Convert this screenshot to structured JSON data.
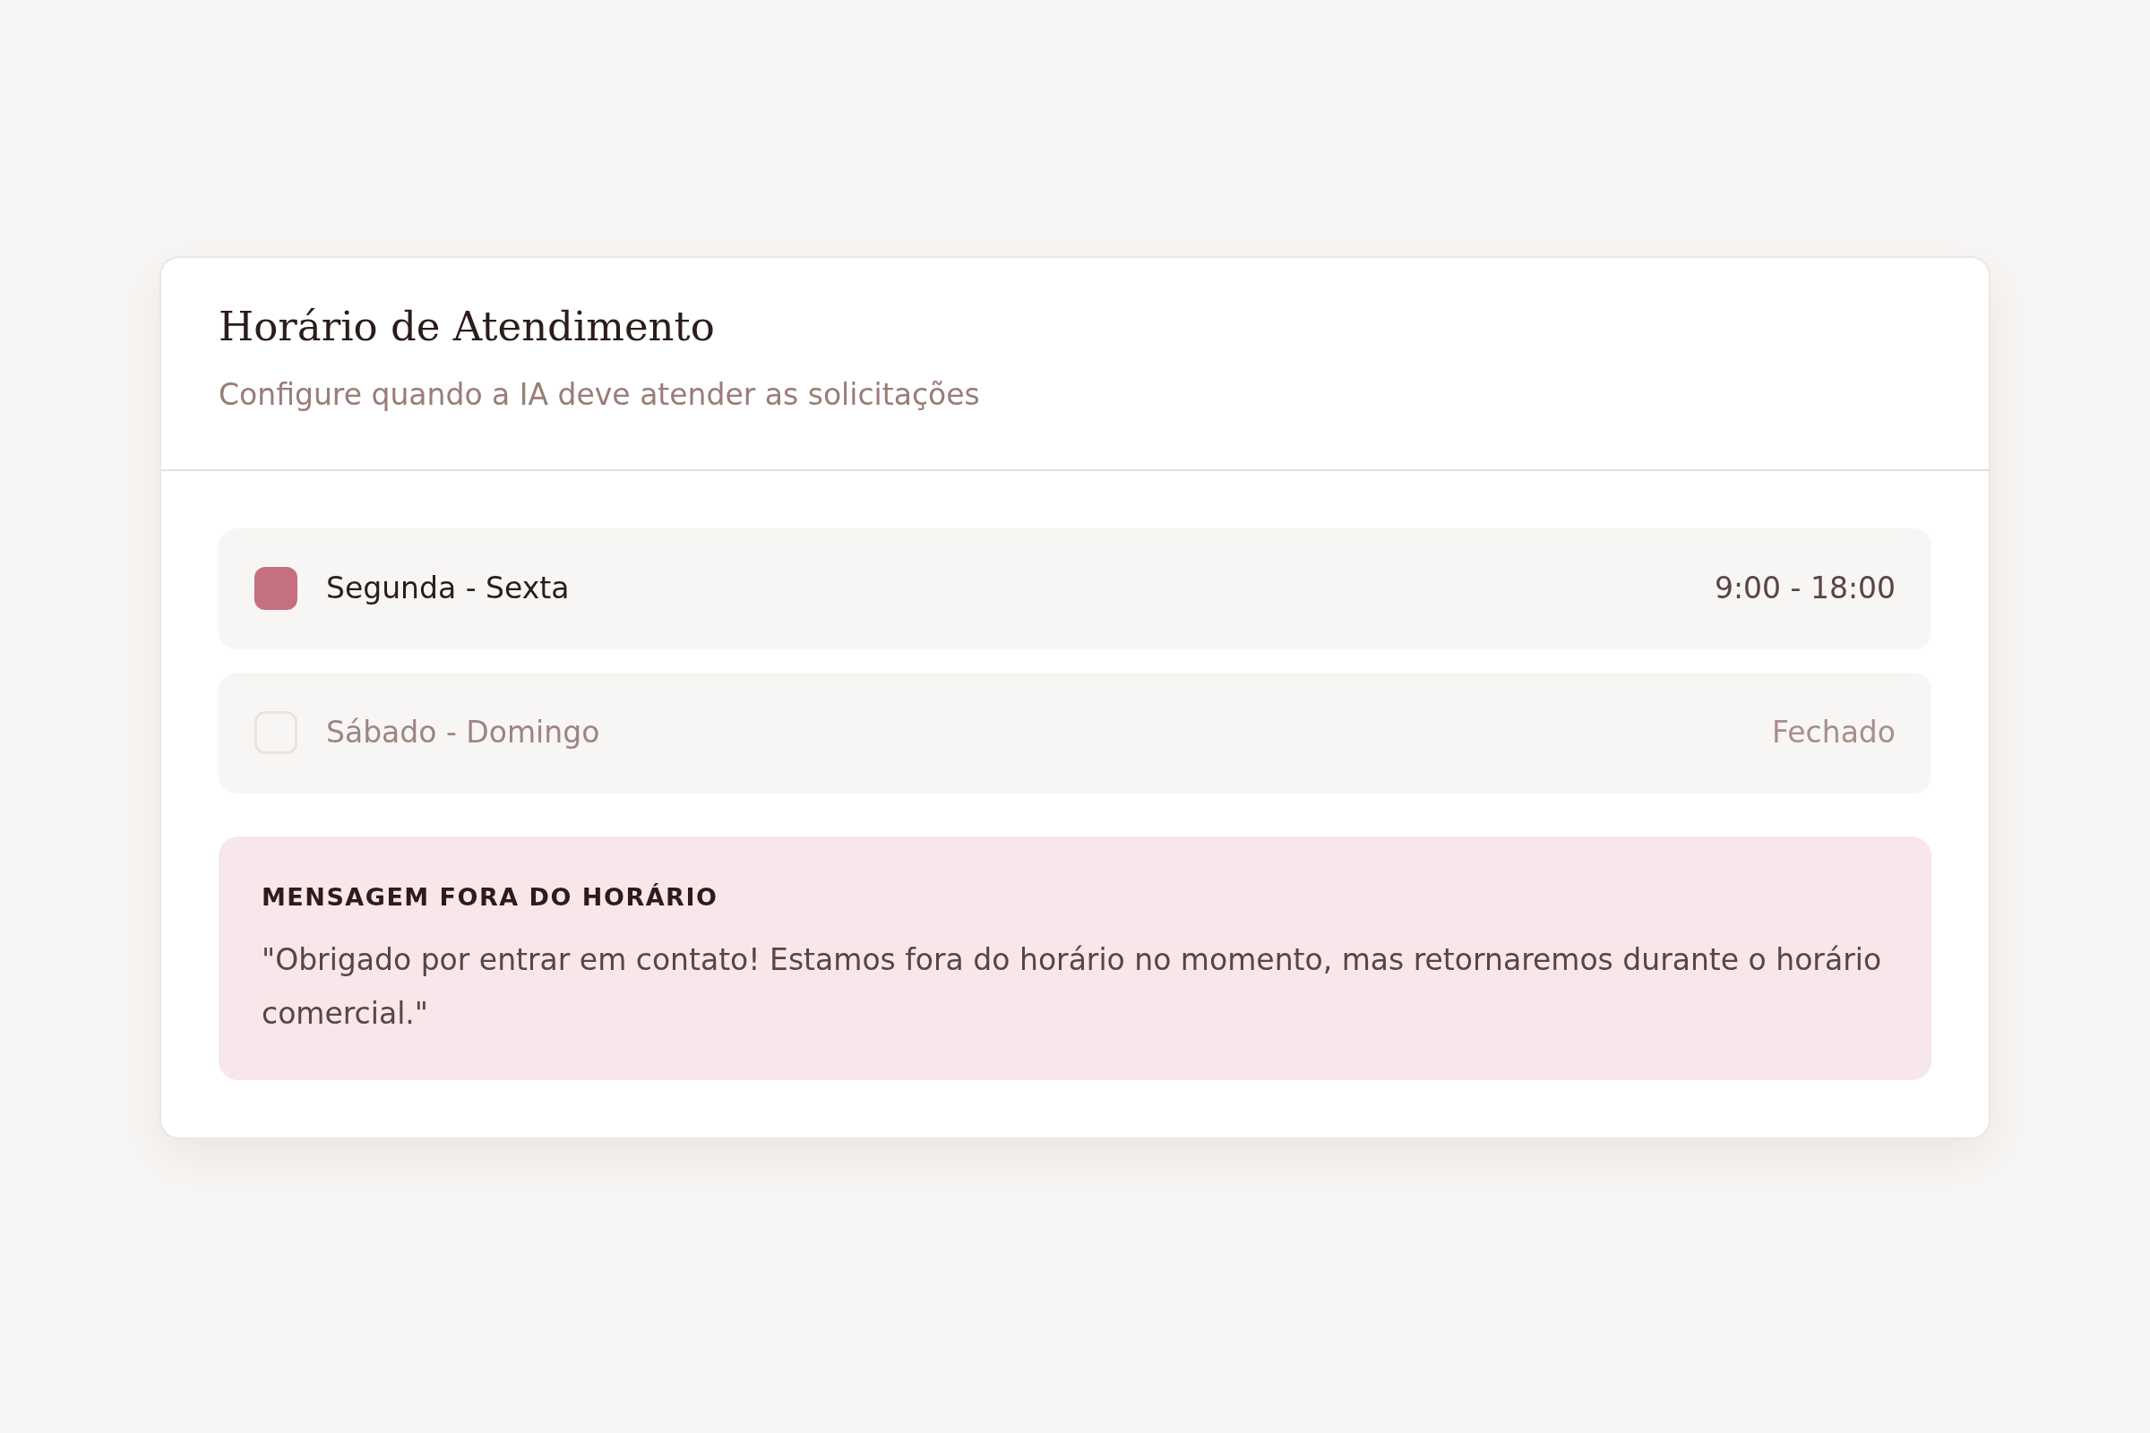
{
  "card": {
    "title": "Horário de Atendimento",
    "subtitle": "Configure quando a IA deve atender as solicitações"
  },
  "schedules": [
    {
      "label": "Segunda - Sexta",
      "checked": true,
      "hours": "9:00 - 18:00"
    },
    {
      "label": "Sábado - Domingo",
      "checked": false,
      "hours": "Fechado"
    }
  ],
  "off_hours_message": {
    "heading": "MENSAGEM FORA DO HORÁRIO",
    "text": "\"Obrigado por entrar em contato! Estamos fora do horário no momento, mas retornaremos durante o horário comercial.\""
  }
}
